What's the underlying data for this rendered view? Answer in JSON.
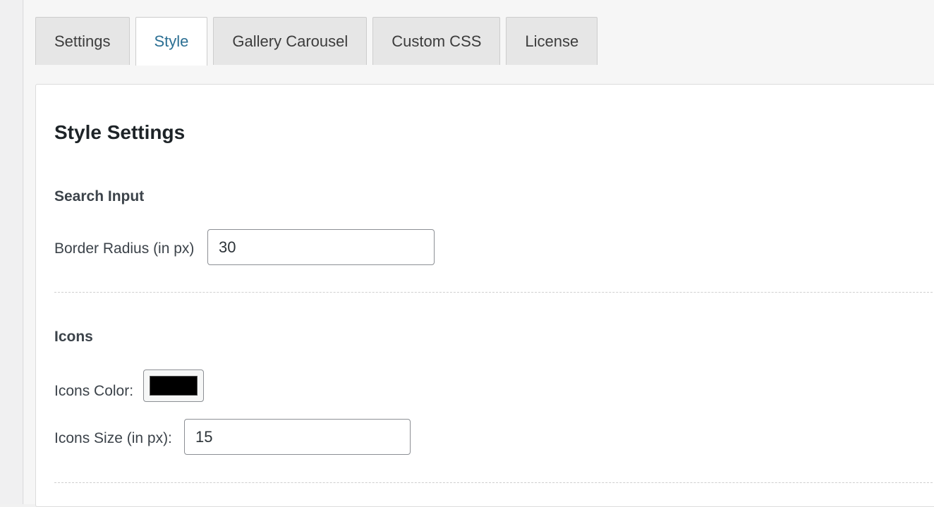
{
  "tabs": [
    {
      "label": "Settings",
      "active": false
    },
    {
      "label": "Style",
      "active": true
    },
    {
      "label": "Gallery Carousel",
      "active": false
    },
    {
      "label": "Custom CSS",
      "active": false
    },
    {
      "label": "License",
      "active": false
    }
  ],
  "panel": {
    "title": "Style Settings",
    "search_input": {
      "section_title": "Search Input",
      "border_radius_label": "Border Radius (in px)",
      "border_radius_value": "30"
    },
    "icons": {
      "section_title": "Icons",
      "color_label": "Icons Color:",
      "color_value": "#000000",
      "size_label": "Icons Size (in px):",
      "size_value": "15"
    }
  },
  "colors": {
    "active_tab_text": "#2b6f93",
    "tab_background": "#e6e6e6",
    "panel_background": "#ffffff"
  }
}
